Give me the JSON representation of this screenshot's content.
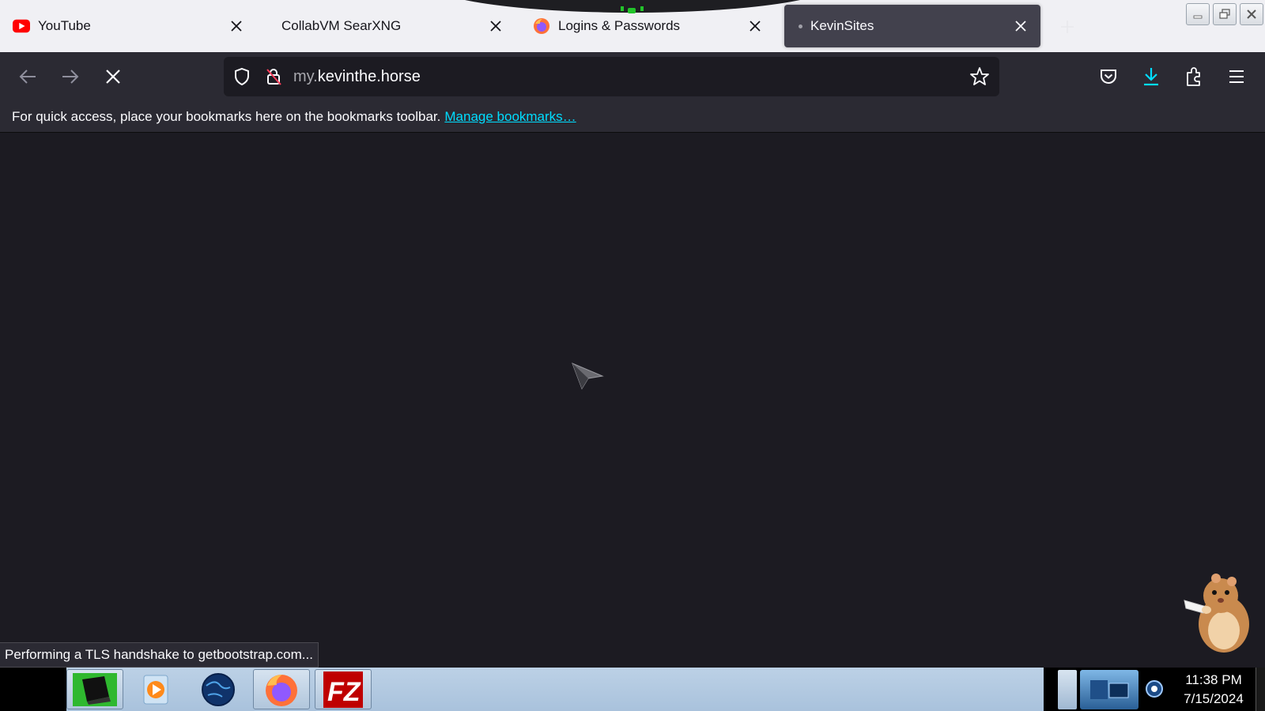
{
  "tabs": [
    {
      "label": "YouTube",
      "favicon": "youtube-icon",
      "active": false
    },
    {
      "label": "CollabVM SearXNG",
      "favicon": "",
      "active": false
    },
    {
      "label": "Logins & Passwords",
      "favicon": "firefox-icon",
      "active": false
    },
    {
      "label": "KevinSites",
      "favicon": "loading-dot",
      "active": true
    }
  ],
  "url": {
    "prefix": "my.",
    "domain": "kevinthe.horse"
  },
  "bookmarks_bar": {
    "message": "For quick access, place your bookmarks here on the bookmarks toolbar.",
    "link": "Manage bookmarks…"
  },
  "status_text": "Performing a TLS handshake to getbootstrap.com...",
  "clock": {
    "time": "11:38 PM",
    "date": "7/15/2024"
  },
  "colors": {
    "accent": "#00ddff",
    "toolbar": "#2b2a33",
    "content": "#1c1b22",
    "tabstrip": "#f0f0f4",
    "youtube_red": "#ff0000"
  }
}
